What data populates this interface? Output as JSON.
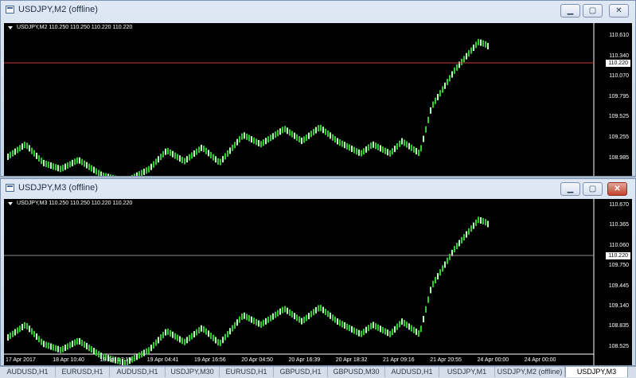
{
  "windows": [
    {
      "title": "USDJPY,M2 (offline)",
      "info": "USDJPY,M2  110.250 110.250 110.220 110.220",
      "price_ticks": [
        "110.610",
        "110.340",
        "110.070",
        "109.795",
        "109.525",
        "109.255",
        "108.985"
      ],
      "current_price": "110.220",
      "time_ticks": [],
      "buttons": {
        "minimize": "▁",
        "maximize": "▢",
        "close": "✕"
      }
    },
    {
      "title": "USDJPY,M3 (offline)",
      "info": "USDJPY,M3  110.250 110.250 110.220 110.220",
      "price_ticks": [
        "110.670",
        "110.365",
        "110.060",
        "109.750",
        "109.445",
        "109.140",
        "108.835",
        "108.525"
      ],
      "current_price": "110.220",
      "time_ticks": [
        "17 Apr 2017",
        "18 Apr 10:40",
        "18 Apr 17:19",
        "19 Apr 04:41",
        "19 Apr 16:56",
        "20 Apr 04:50",
        "20 Apr 16:39",
        "20 Apr 18:32",
        "21 Apr 09:16",
        "21 Apr 20:55",
        "24 Apr 00:00",
        "24 Apr 00:00"
      ],
      "buttons": {
        "minimize": "▁",
        "maximize": "▢",
        "close": "✕"
      }
    }
  ],
  "colors": {
    "bullish": "#2ecc2e",
    "bullish_light": "#b8ffb8",
    "grid_line": "#8a8a8a",
    "price_line": "#c83c3c"
  },
  "tabs": [
    {
      "label": "AUDUSD,H1",
      "active": false
    },
    {
      "label": "EURUSD,H1",
      "active": false
    },
    {
      "label": "AUDUSD,H1",
      "active": false
    },
    {
      "label": "USDJPY,M30",
      "active": false
    },
    {
      "label": "EURUSD,H1",
      "active": false
    },
    {
      "label": "GBPUSD,H1",
      "active": false
    },
    {
      "label": "GBPUSD,M30",
      "active": false
    },
    {
      "label": "AUDUSD,H1",
      "active": false
    },
    {
      "label": "USDJPY,M1",
      "active": false
    },
    {
      "label": "USDJPY,M2 (offline)",
      "active": false
    },
    {
      "label": "USDJPY,M3",
      "active": true
    }
  ]
}
